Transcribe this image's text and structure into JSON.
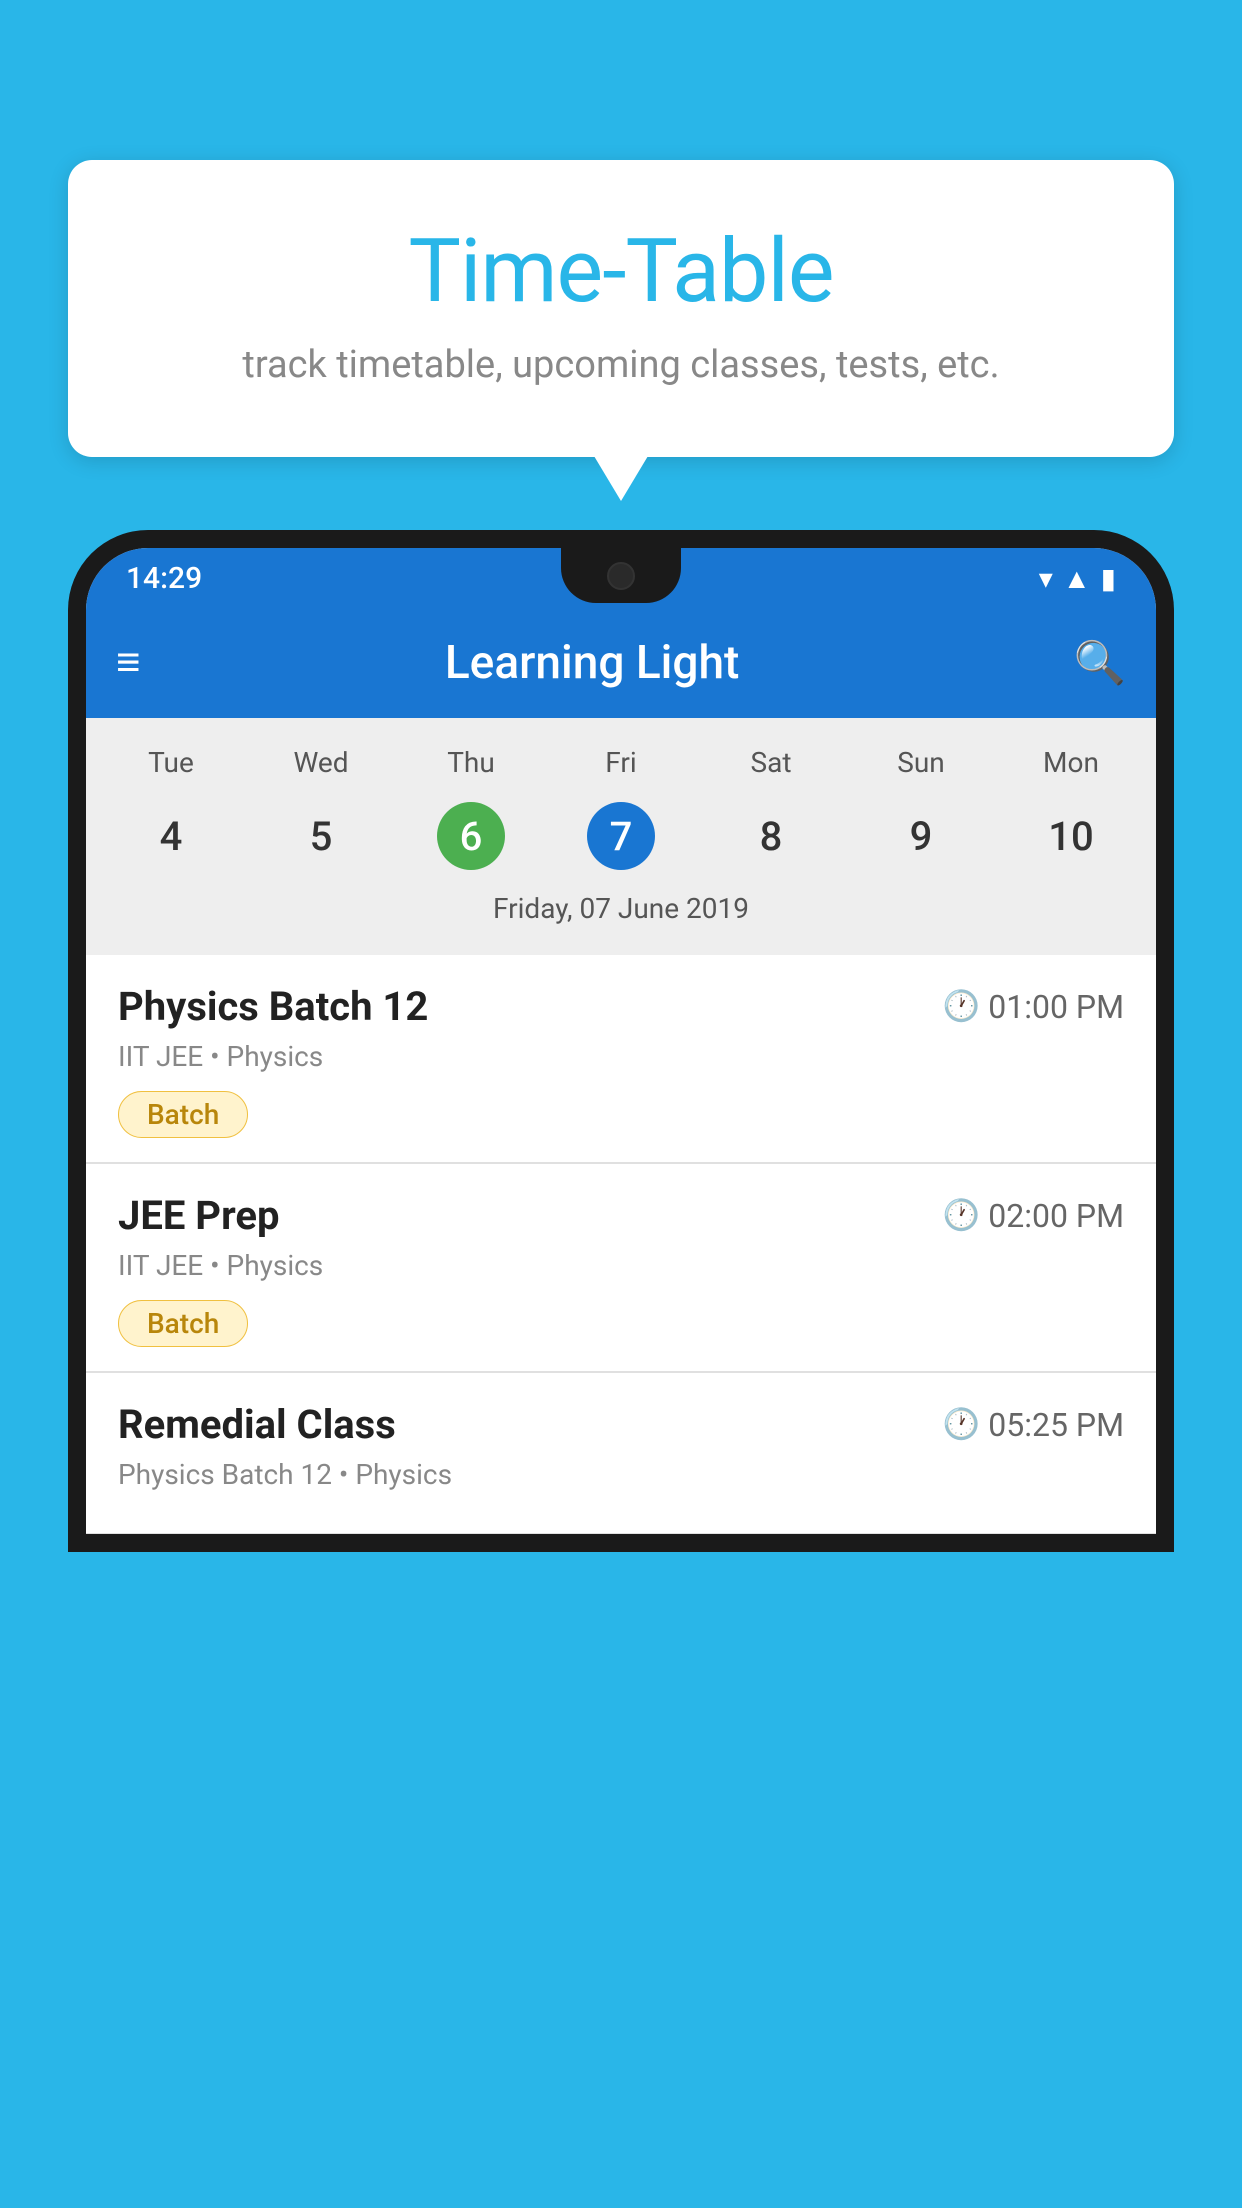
{
  "background": {
    "color": "#29B6E8"
  },
  "tooltip": {
    "title": "Time-Table",
    "subtitle": "track timetable, upcoming classes, tests, etc."
  },
  "phone": {
    "statusBar": {
      "time": "14:29"
    },
    "appBar": {
      "title": "Learning Light",
      "menuIcon": "≡",
      "searchIcon": "🔍"
    },
    "calendar": {
      "days": [
        "Tue",
        "Wed",
        "Thu",
        "Fri",
        "Sat",
        "Sun",
        "Mon"
      ],
      "dates": [
        "4",
        "5",
        "6",
        "7",
        "8",
        "9",
        "10"
      ],
      "todayIndex": 2,
      "selectedIndex": 3,
      "selectedDateLabel": "Friday, 07 June 2019"
    },
    "classes": [
      {
        "name": "Physics Batch 12",
        "time": "01:00 PM",
        "detail": "IIT JEE • Physics",
        "badge": "Batch"
      },
      {
        "name": "JEE Prep",
        "time": "02:00 PM",
        "detail": "IIT JEE • Physics",
        "badge": "Batch"
      },
      {
        "name": "Remedial Class",
        "time": "05:25 PM",
        "detail": "Physics Batch 12 • Physics",
        "badge": ""
      }
    ]
  }
}
